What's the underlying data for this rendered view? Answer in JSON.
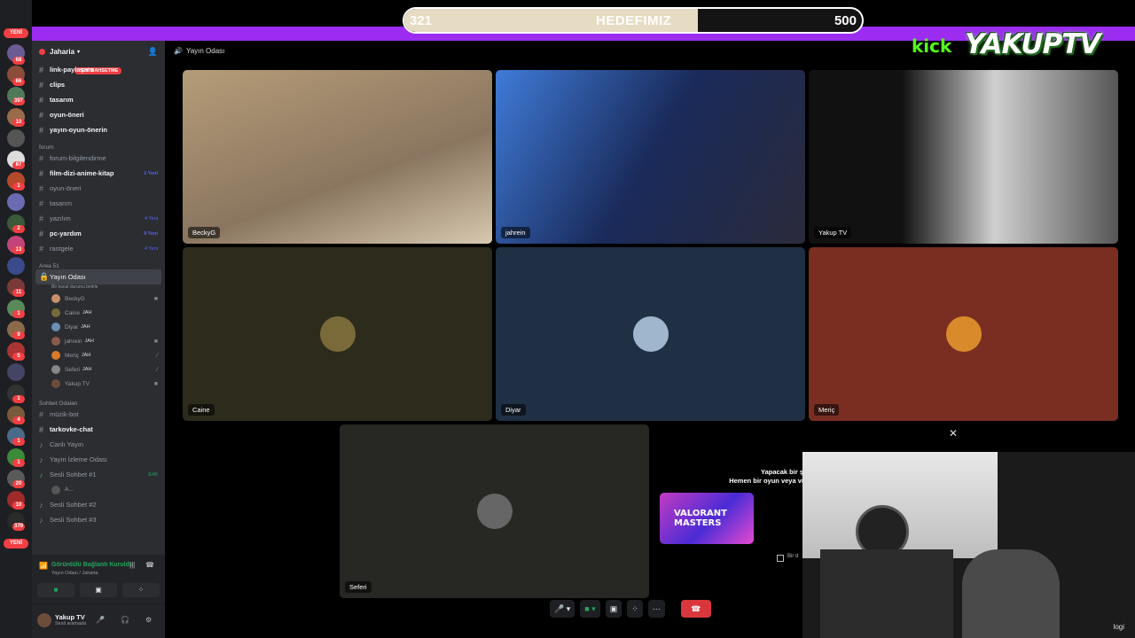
{
  "goal": {
    "current": "321",
    "label": "HEDEFIMIZ",
    "target": "500",
    "progress_fraction": 0.642
  },
  "overlay": {
    "kick": "kick",
    "brand": "YAKUPTV"
  },
  "rail": {
    "new_top": "YENİ",
    "new_bottom": "YENİ",
    "badges": [
      "68",
      "66",
      "397",
      "10",
      "87",
      "1",
      "2",
      "13",
      "11",
      "1",
      "9",
      "5",
      "1",
      "4",
      "1",
      "1",
      "20",
      "10",
      "379"
    ]
  },
  "sidebar": {
    "server_name": "Jaharia",
    "new_badge": "YENİ BAHSETME",
    "channels_top": [
      {
        "name": "link-paylaşımı",
        "bold": true
      },
      {
        "name": "clips",
        "bold": true
      },
      {
        "name": "tasarım",
        "bold": true
      },
      {
        "name": "oyun-öneri",
        "bold": true
      },
      {
        "name": "yayın-oyun-önerin",
        "bold": true
      }
    ],
    "forum_category": "forum",
    "forum_channels": [
      {
        "name": "forum-bilgilendirme",
        "bold": false,
        "count": ""
      },
      {
        "name": "film-dizi-anime-kitap",
        "bold": true,
        "count": "1 Yeni"
      },
      {
        "name": "oyun-öneri",
        "bold": false,
        "count": ""
      },
      {
        "name": "tasarım",
        "bold": false,
        "count": ""
      },
      {
        "name": "yazılım",
        "bold": false,
        "count": "4 Yeni"
      },
      {
        "name": "pc-yardım",
        "bold": true,
        "count": "9 Yeni"
      },
      {
        "name": "rastgele",
        "bold": false,
        "count": "4 Yeni"
      }
    ],
    "area_category": "Area 51",
    "active_channel": "Yayın Odası",
    "active_sub": "Bir kanal durumu belirle",
    "members": [
      {
        "name": "BeckyG",
        "tag": "",
        "color": "#c98f6b"
      },
      {
        "name": "Caine",
        "tag": "JAH",
        "color": "#7a6a3a"
      },
      {
        "name": "Diyar",
        "tag": "JAH",
        "color": "#6b8fb3"
      },
      {
        "name": "jahrein",
        "tag": "JAH",
        "color": "#8a5a4a"
      },
      {
        "name": "Meriç",
        "tag": "JAH",
        "color": "#d97a2a"
      },
      {
        "name": "Seferi",
        "tag": "JAH",
        "color": "#888888"
      },
      {
        "name": "Yakup TV",
        "tag": "",
        "color": "#6d4d3a"
      }
    ],
    "chat_category": "Sohbet Odaları",
    "chat_channels": [
      {
        "name": "müzik-bot",
        "bold": false
      },
      {
        "name": "tarkovke-chat",
        "bold": true
      },
      {
        "name": "Canlı Yayın",
        "bold": false
      },
      {
        "name": "Yayın İzleme Odası",
        "bold": false
      },
      {
        "name": "Sesli Sohbet #1",
        "bold": false,
        "count": "6/45"
      },
      {
        "name": "A...",
        "bold": false
      },
      {
        "name": "Sesli Sohbet #2",
        "bold": false
      },
      {
        "name": "Sesli Sohbet #3",
        "bold": false
      }
    ],
    "voice_status": "Görüntülü Bağlantı Kuruldu",
    "voice_sub": "Yayın Odası / Jaharia",
    "user_name": "Yakup TV",
    "user_status": "Sesli aramada"
  },
  "call": {
    "title": "Yayın Odası",
    "tiles": [
      {
        "name": "BeckyG",
        "bg": "#a8926e"
      },
      {
        "name": "jahrein",
        "bg": "#3d5a8a"
      },
      {
        "name": "Yakup TV",
        "bg": "#3a3a3a"
      },
      {
        "name": "Caine",
        "bg": "#2d2b1b"
      },
      {
        "name": "Diyar",
        "bg": "#1f3044"
      },
      {
        "name": "Meriç",
        "bg": "#7a2e22"
      },
      {
        "name": "Seferi",
        "bg": "#272724"
      }
    ],
    "promo_line1": "Yapacak bir ş",
    "promo_line2": "Hemen bir oyun veya vi",
    "promo_game": "VALORANT MASTERS",
    "promo_checkbox": "Bir d",
    "webcam_logo": "logi"
  },
  "icons": {
    "hash": "#",
    "speaker": "🔊",
    "mic": "🎤",
    "camera": "📹",
    "screen": "🖥",
    "grid": "⊞",
    "more": "⋯",
    "hangup": "☎",
    "close": "✕",
    "headset": "🎧",
    "gear": "⚙"
  }
}
